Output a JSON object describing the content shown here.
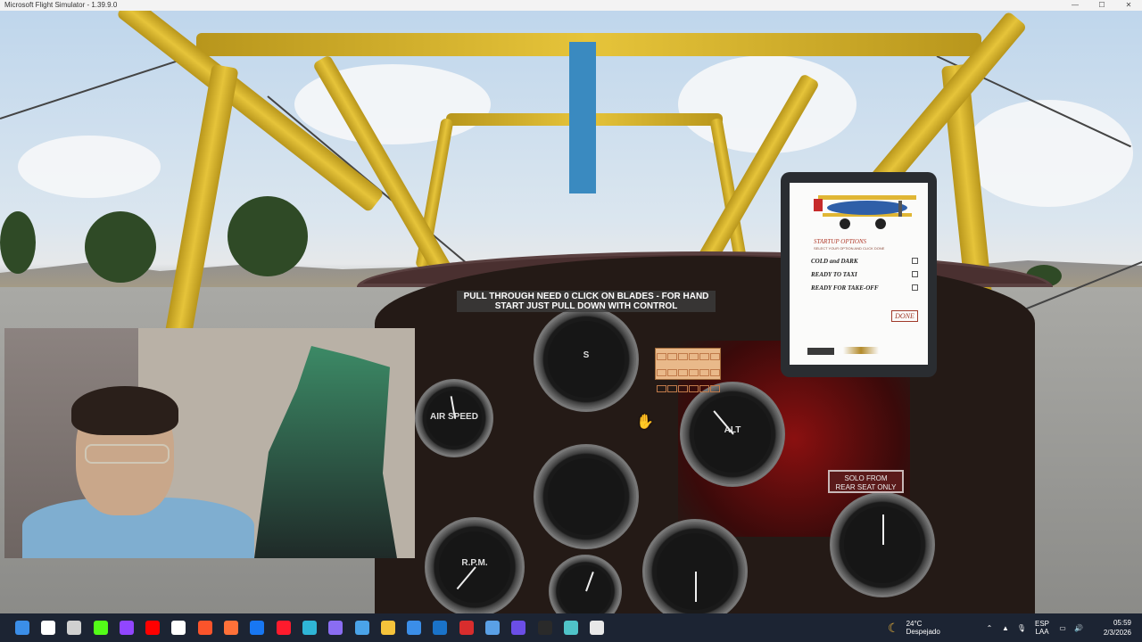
{
  "window": {
    "title": "Microsoft Flight Simulator - 1.39.9.0",
    "controls": [
      "—",
      "☐",
      "✕"
    ]
  },
  "cockpit": {
    "message_line1": "PULL THROUGH NEED 0 CLICK ON BLADES - FOR HAND",
    "message_line2": "START JUST PULL DOWN WITH CONTROL",
    "solo_plate_line1": "SOLO FROM",
    "solo_plate_line2": "REAR SEAT ONLY",
    "airspeed_label": "AIR SPEED",
    "rpm_label": "R.P.M.",
    "altimeter_label": "ALT",
    "compass_label": "S"
  },
  "tablet": {
    "title": "STARTUP OPTIONS",
    "subtitle": "SELECT YOUR OPTION AND CLICK DONE",
    "options": [
      {
        "label": "COLD and DARK",
        "checked": false
      },
      {
        "label": "READY TO TAXI",
        "checked": false
      },
      {
        "label": "READY FOR TAKE-OFF",
        "checked": false
      }
    ],
    "done_label": "DONE"
  },
  "taskbar": {
    "icons": [
      {
        "name": "windows-start-icon",
        "color": "#3b8ee8"
      },
      {
        "name": "search-icon",
        "color": "#ffffff"
      },
      {
        "name": "task-view-icon",
        "color": "#d0d0d0"
      },
      {
        "name": "kick-icon",
        "color": "#53fc18"
      },
      {
        "name": "twitch-icon",
        "color": "#9146ff"
      },
      {
        "name": "youtube-icon",
        "color": "#ff0000"
      },
      {
        "name": "x-icon",
        "color": "#ffffff"
      },
      {
        "name": "brave-icon",
        "color": "#fb542b"
      },
      {
        "name": "firefox-icon",
        "color": "#ff7139"
      },
      {
        "name": "facebook-icon",
        "color": "#1877f2"
      },
      {
        "name": "opera-icon",
        "color": "#ff1b2d"
      },
      {
        "name": "edge-icon",
        "color": "#2fb5d6"
      },
      {
        "name": "copilot-icon",
        "color": "#8a6df2"
      },
      {
        "name": "photos-icon",
        "color": "#4aa3e8"
      },
      {
        "name": "file-explorer-icon",
        "color": "#f5c33b"
      },
      {
        "name": "store-icon",
        "color": "#3b8ee8"
      },
      {
        "name": "outlook-icon",
        "color": "#1a73c9"
      },
      {
        "name": "streamer-app-icon",
        "color": "#d92d2d"
      },
      {
        "name": "snipping-tool-icon",
        "color": "#5aa0e6"
      },
      {
        "name": "vivaldi-icon",
        "color": "#6b4ee6"
      },
      {
        "name": "flight-simulator-icon",
        "color": "#2a2a2a"
      },
      {
        "name": "globe-app-icon",
        "color": "#4fc3c8"
      },
      {
        "name": "chatgpt-icon",
        "color": "#e8e8e8"
      }
    ],
    "weather_temp": "24°C",
    "weather_desc": "Despejado",
    "language_line1": "ESP",
    "language_line2": "LAA",
    "time": "05:59",
    "date": "2/3/2026"
  }
}
